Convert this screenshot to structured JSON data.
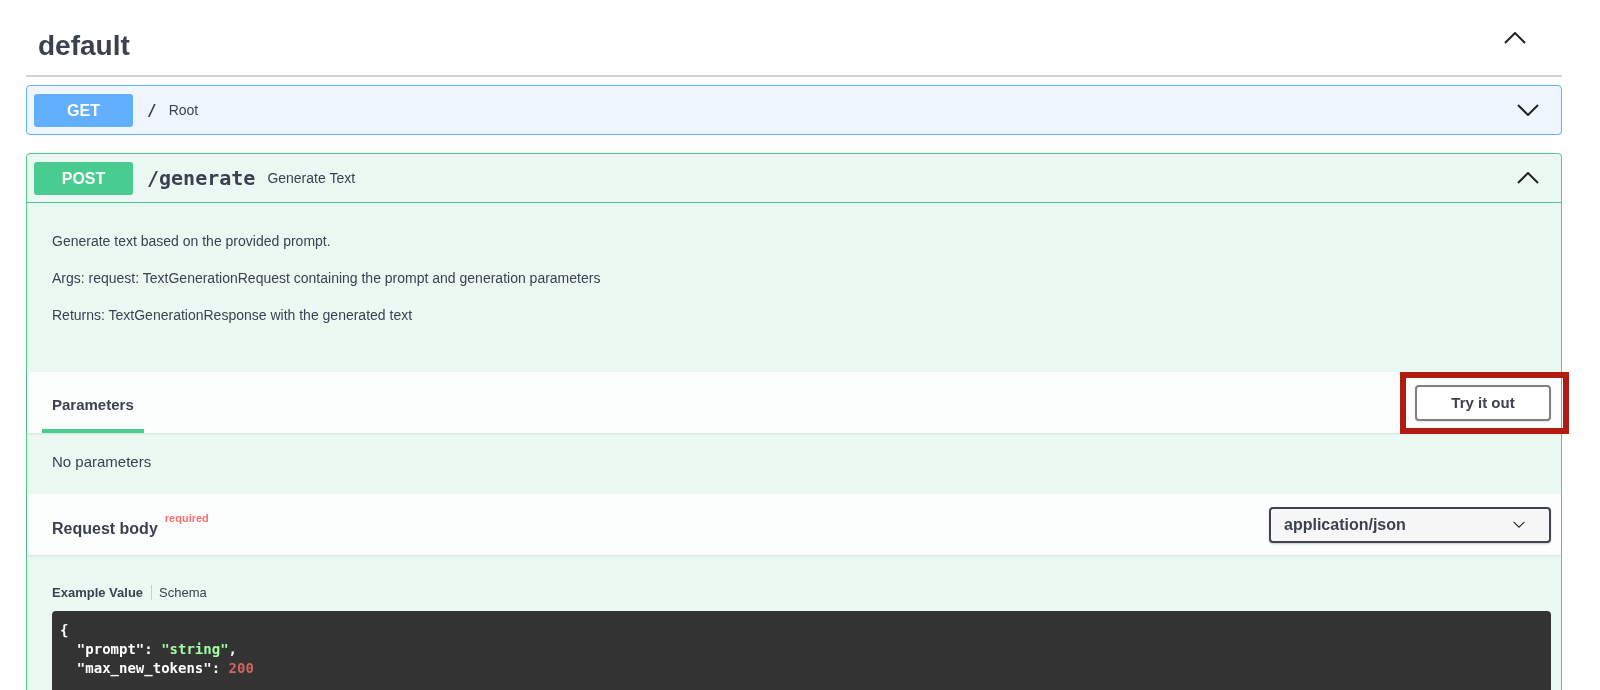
{
  "section": {
    "title": "default",
    "expanded": true
  },
  "operations": [
    {
      "method": "GET",
      "path": "/",
      "summary": "Root",
      "expanded": false
    },
    {
      "method": "POST",
      "path": "/generate",
      "summary": "Generate Text",
      "expanded": true,
      "description": [
        "Generate text based on the provided prompt.",
        "Args: request: TextGenerationRequest containing the prompt and generation parameters",
        "Returns: TextGenerationResponse with the generated text"
      ],
      "tabs": [
        {
          "label": "Parameters",
          "selected": true
        }
      ],
      "try_button": {
        "label": "Try it out",
        "highlighted": true
      },
      "parameters_note": "No parameters",
      "request_body": {
        "title": "Request body",
        "required_label": "required",
        "content_type": "application/json",
        "example_tabs": [
          {
            "label": "Example Value",
            "selected": true
          },
          {
            "label": "Schema",
            "selected": false
          }
        ],
        "code_lines": [
          [
            {
              "kind": "punct",
              "text": "{"
            }
          ],
          [
            {
              "kind": "key",
              "text": "  \"prompt\""
            },
            {
              "kind": "punct",
              "text": ": "
            },
            {
              "kind": "string",
              "text": "\"string\""
            },
            {
              "kind": "punct",
              "text": ","
            }
          ],
          [
            {
              "kind": "key",
              "text": "  \"max_new_tokens\""
            },
            {
              "kind": "punct",
              "text": ": "
            },
            {
              "kind": "number",
              "text": "200"
            }
          ]
        ]
      }
    }
  ]
}
